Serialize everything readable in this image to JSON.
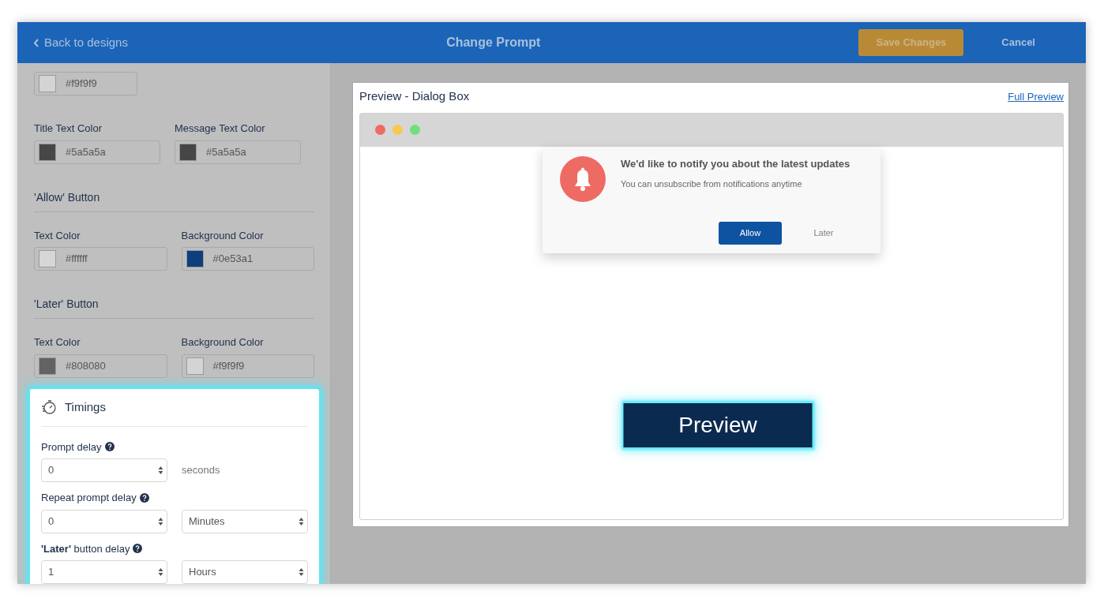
{
  "header": {
    "back_link": "Back to designs",
    "title": "Change Prompt",
    "save_button": "Save Changes",
    "cancel_button": "Cancel"
  },
  "sidebar": {
    "sections": [
      {
        "fields": [
          {
            "value": "#f9f9f9",
            "color": "#d4d4d4"
          }
        ]
      },
      {
        "fields": [
          {
            "label": "Title Text Color",
            "value": "#5a5a5a",
            "color": "#464646"
          },
          {
            "label": "Message Text Color",
            "value": "#5a5a5a",
            "color": "#464646"
          }
        ]
      },
      {
        "heading": "'Allow' Button",
        "fields": [
          {
            "label": "Text Color",
            "value": "#ffffff",
            "color": "#d6d6d6"
          },
          {
            "label": "Background Color",
            "value": "#0e53a1",
            "color": "#0e3f7c"
          }
        ]
      },
      {
        "heading": "'Later' Button",
        "fields": [
          {
            "label": "Text Color",
            "value": "#808080",
            "color": "#636363"
          },
          {
            "label": "Background Color",
            "value": "#f9f9f9",
            "color": "#d4d4d4"
          }
        ]
      }
    ]
  },
  "timings": {
    "title": "Timings",
    "rows": [
      {
        "label": "Prompt delay",
        "value": "0",
        "unit": {
          "kind": "text",
          "text": "seconds"
        }
      },
      {
        "label": "Repeat prompt delay",
        "value": "0",
        "unit": {
          "kind": "select",
          "text": "Minutes"
        }
      },
      {
        "label": "**'Later'** button delay",
        "value": "1",
        "unit": {
          "kind": "select",
          "text": "Hours"
        }
      }
    ]
  },
  "preview": {
    "title": "Preview - Dialog Box",
    "full_preview_link": "Full Preview",
    "window_dots": [
      {
        "color": "#ee6b63"
      },
      {
        "color": "#f7c952"
      },
      {
        "color": "#6fe07f"
      }
    ],
    "dialog": {
      "title": "We'd like to notify you about the latest updates",
      "message": "You can unsubscribe from notifications anytime",
      "allow_button": "Allow",
      "later_button": "Later"
    },
    "overlay_label": "Preview"
  }
}
